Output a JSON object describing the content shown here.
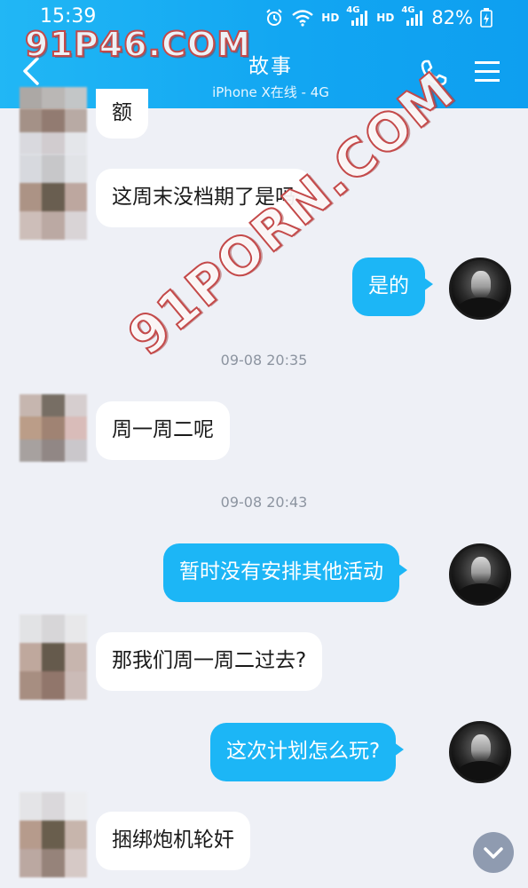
{
  "status_bar": {
    "time": "15:39",
    "network1": "HD",
    "network2": "HD",
    "signal_label1": "4G",
    "signal_label2": "4G",
    "battery": "82%"
  },
  "header": {
    "title": "故事",
    "subtitle": "iPhone X在线 - 4G",
    "accent_color": "#12a6f2"
  },
  "watermarks": [
    "91P46.COM",
    "91PORN.COM"
  ],
  "messages": [
    {
      "side": "in",
      "text": "额"
    },
    {
      "side": "in",
      "text": "这周末没档期了是吗"
    },
    {
      "side": "out",
      "text": "是的"
    },
    {
      "timestamp": "09-08 20:35"
    },
    {
      "side": "in",
      "text": "周一周二呢"
    },
    {
      "timestamp": "09-08 20:43"
    },
    {
      "side": "out",
      "text": "暂时没有安排其他活动"
    },
    {
      "side": "in",
      "text": "那我们周一周二过去?"
    },
    {
      "side": "out",
      "text": "这次计划怎么玩?"
    },
    {
      "side": "in",
      "text": "捆绑炮机轮奸"
    }
  ],
  "icons": [
    "back-icon",
    "phone-icon",
    "menu-icon",
    "alarm-icon",
    "wifi-icon",
    "signal-icon",
    "battery-icon",
    "chevron-down-icon"
  ]
}
